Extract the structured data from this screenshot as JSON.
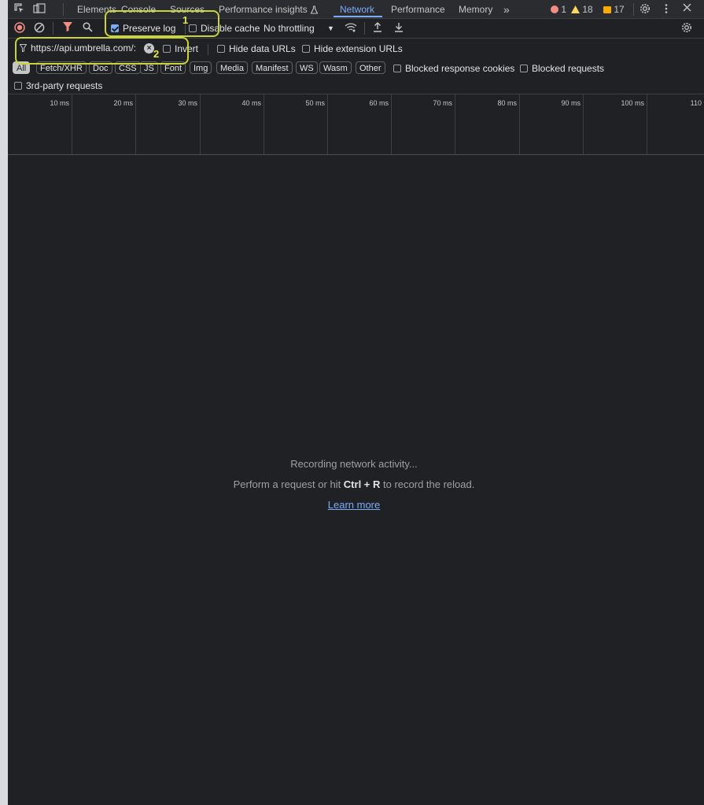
{
  "tabs": {
    "elements": "Elements",
    "console": "Console",
    "sources": "Sources",
    "performance_insights": "Performance insights",
    "network": "Network",
    "performance": "Performance",
    "memory": "Memory",
    "more": "»"
  },
  "status": {
    "errors": "1",
    "warnings": "18",
    "issues": "17",
    "error_color": "#f28b82",
    "warning_color": "#fdd663",
    "issue_color": "#f9ab00"
  },
  "toolbar": {
    "preserve_log": "Preserve log",
    "disable_cache": "Disable cache",
    "throttling": "No throttling"
  },
  "filter": {
    "value": "https://api.umbrella.com/:",
    "invert": "Invert",
    "hide_data_urls": "Hide data URLs",
    "hide_extension_urls": "Hide extension URLs"
  },
  "types": [
    "All",
    "Fetch/XHR",
    "Doc",
    "CSS",
    "JS",
    "Font",
    "Img",
    "Media",
    "Manifest",
    "WS",
    "Wasm",
    "Other"
  ],
  "options": {
    "blocked_response_cookies": "Blocked response cookies",
    "blocked_requests": "Blocked requests",
    "third_party": "3rd-party requests"
  },
  "timeline": {
    "ticks": [
      "10 ms",
      "20 ms",
      "30 ms",
      "40 ms",
      "50 ms",
      "60 ms",
      "70 ms",
      "80 ms",
      "90 ms",
      "100 ms",
      "110"
    ]
  },
  "empty": {
    "line1": "Recording network activity...",
    "line2_pre": "Perform a request or hit ",
    "line2_key": "Ctrl + R",
    "line2_post": " to record the reload.",
    "learn_more": "Learn more"
  },
  "annotations": {
    "one": "1",
    "two": "2",
    "color": "#c9d33a"
  }
}
